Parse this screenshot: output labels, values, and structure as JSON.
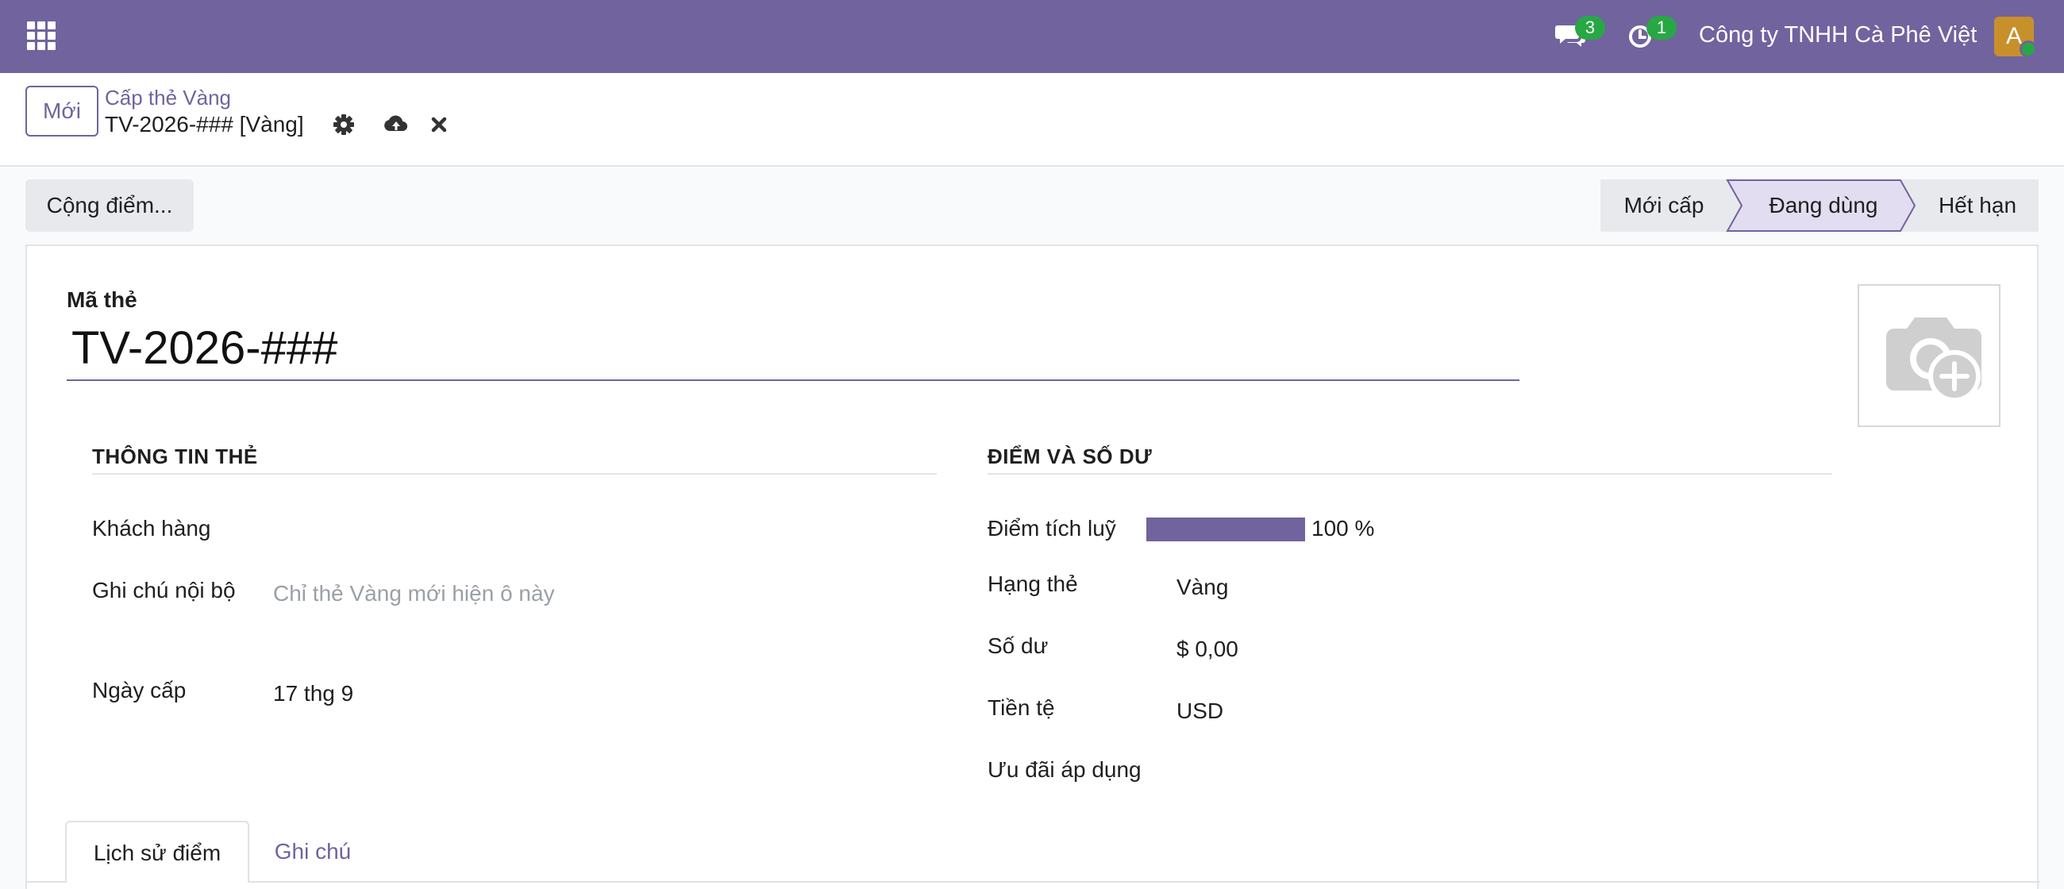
{
  "navbar": {
    "messages_count": "3",
    "activities_count": "1",
    "company": "Công ty TNHH Cà Phê Việt",
    "avatar_initial": "A",
    "colors": {
      "primary": "#71639e",
      "badge": "#28a745",
      "avatar": "#c8902b"
    }
  },
  "control_panel": {
    "new_button": "Mới",
    "breadcrumb_parent": "Cấp thẻ Vàng",
    "record_title": "TV-2026-### [Vàng]",
    "icons": [
      "gear-icon",
      "cloud-upload-icon",
      "close-icon"
    ]
  },
  "actions": {
    "add_points_button": "Cộng điểm..."
  },
  "statusbar": {
    "steps": [
      {
        "label": "Mới cấp",
        "active": false
      },
      {
        "label": "Đang dùng",
        "active": true
      },
      {
        "label": "Hết hạn",
        "active": false
      }
    ]
  },
  "form": {
    "code_label": "Mã thẻ",
    "code_value": "TV-2026-###",
    "card_info": {
      "title": "THÔNG TIN THẺ",
      "customer_label": "Khách hàng",
      "customer_value": "",
      "internal_note_label": "Ghi chú nội bộ",
      "internal_note_placeholder": "Chỉ thẻ Vàng mới hiện ô này",
      "issue_date_label": "Ngày cấp",
      "issue_date_value": "17 thg 9"
    },
    "points_balance": {
      "title": "ĐIỂM VÀ SỐ DƯ",
      "points_label": "Điểm tích luỹ",
      "points_percent": 100,
      "points_text": "100 %",
      "tier_label": "Hạng thẻ",
      "tier_value": "Vàng",
      "balance_label": "Số dư",
      "balance_value": "$ 0,00",
      "currency_label": "Tiền tệ",
      "currency_value": "USD",
      "offers_label": "Ưu đãi áp dụng",
      "offers_value": ""
    }
  },
  "tabs": [
    {
      "label": "Lịch sử điểm",
      "active": true
    },
    {
      "label": "Ghi chú",
      "active": false
    }
  ]
}
